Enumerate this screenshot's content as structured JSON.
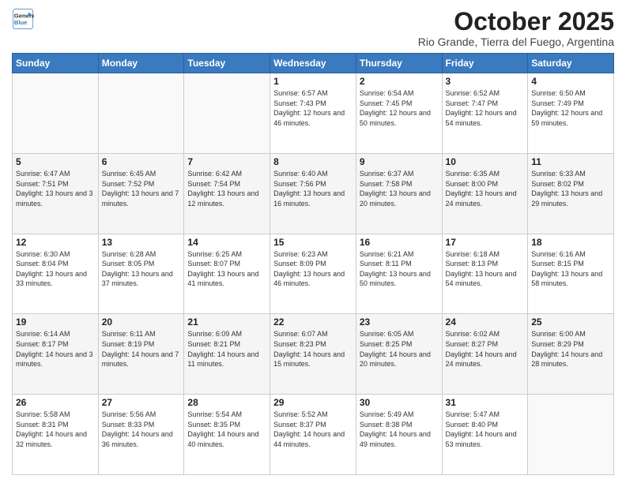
{
  "logo": {
    "line1": "General",
    "line2": "Blue"
  },
  "header": {
    "month": "October 2025",
    "location": "Rio Grande, Tierra del Fuego, Argentina"
  },
  "weekdays": [
    "Sunday",
    "Monday",
    "Tuesday",
    "Wednesday",
    "Thursday",
    "Friday",
    "Saturday"
  ],
  "weeks": [
    [
      {
        "day": "",
        "info": ""
      },
      {
        "day": "",
        "info": ""
      },
      {
        "day": "",
        "info": ""
      },
      {
        "day": "1",
        "info": "Sunrise: 6:57 AM\nSunset: 7:43 PM\nDaylight: 12 hours\nand 46 minutes."
      },
      {
        "day": "2",
        "info": "Sunrise: 6:54 AM\nSunset: 7:45 PM\nDaylight: 12 hours\nand 50 minutes."
      },
      {
        "day": "3",
        "info": "Sunrise: 6:52 AM\nSunset: 7:47 PM\nDaylight: 12 hours\nand 54 minutes."
      },
      {
        "day": "4",
        "info": "Sunrise: 6:50 AM\nSunset: 7:49 PM\nDaylight: 12 hours\nand 59 minutes."
      }
    ],
    [
      {
        "day": "5",
        "info": "Sunrise: 6:47 AM\nSunset: 7:51 PM\nDaylight: 13 hours\nand 3 minutes."
      },
      {
        "day": "6",
        "info": "Sunrise: 6:45 AM\nSunset: 7:52 PM\nDaylight: 13 hours\nand 7 minutes."
      },
      {
        "day": "7",
        "info": "Sunrise: 6:42 AM\nSunset: 7:54 PM\nDaylight: 13 hours\nand 12 minutes."
      },
      {
        "day": "8",
        "info": "Sunrise: 6:40 AM\nSunset: 7:56 PM\nDaylight: 13 hours\nand 16 minutes."
      },
      {
        "day": "9",
        "info": "Sunrise: 6:37 AM\nSunset: 7:58 PM\nDaylight: 13 hours\nand 20 minutes."
      },
      {
        "day": "10",
        "info": "Sunrise: 6:35 AM\nSunset: 8:00 PM\nDaylight: 13 hours\nand 24 minutes."
      },
      {
        "day": "11",
        "info": "Sunrise: 6:33 AM\nSunset: 8:02 PM\nDaylight: 13 hours\nand 29 minutes."
      }
    ],
    [
      {
        "day": "12",
        "info": "Sunrise: 6:30 AM\nSunset: 8:04 PM\nDaylight: 13 hours\nand 33 minutes."
      },
      {
        "day": "13",
        "info": "Sunrise: 6:28 AM\nSunset: 8:05 PM\nDaylight: 13 hours\nand 37 minutes."
      },
      {
        "day": "14",
        "info": "Sunrise: 6:25 AM\nSunset: 8:07 PM\nDaylight: 13 hours\nand 41 minutes."
      },
      {
        "day": "15",
        "info": "Sunrise: 6:23 AM\nSunset: 8:09 PM\nDaylight: 13 hours\nand 46 minutes."
      },
      {
        "day": "16",
        "info": "Sunrise: 6:21 AM\nSunset: 8:11 PM\nDaylight: 13 hours\nand 50 minutes."
      },
      {
        "day": "17",
        "info": "Sunrise: 6:18 AM\nSunset: 8:13 PM\nDaylight: 13 hours\nand 54 minutes."
      },
      {
        "day": "18",
        "info": "Sunrise: 6:16 AM\nSunset: 8:15 PM\nDaylight: 13 hours\nand 58 minutes."
      }
    ],
    [
      {
        "day": "19",
        "info": "Sunrise: 6:14 AM\nSunset: 8:17 PM\nDaylight: 14 hours\nand 3 minutes."
      },
      {
        "day": "20",
        "info": "Sunrise: 6:11 AM\nSunset: 8:19 PM\nDaylight: 14 hours\nand 7 minutes."
      },
      {
        "day": "21",
        "info": "Sunrise: 6:09 AM\nSunset: 8:21 PM\nDaylight: 14 hours\nand 11 minutes."
      },
      {
        "day": "22",
        "info": "Sunrise: 6:07 AM\nSunset: 8:23 PM\nDaylight: 14 hours\nand 15 minutes."
      },
      {
        "day": "23",
        "info": "Sunrise: 6:05 AM\nSunset: 8:25 PM\nDaylight: 14 hours\nand 20 minutes."
      },
      {
        "day": "24",
        "info": "Sunrise: 6:02 AM\nSunset: 8:27 PM\nDaylight: 14 hours\nand 24 minutes."
      },
      {
        "day": "25",
        "info": "Sunrise: 6:00 AM\nSunset: 8:29 PM\nDaylight: 14 hours\nand 28 minutes."
      }
    ],
    [
      {
        "day": "26",
        "info": "Sunrise: 5:58 AM\nSunset: 8:31 PM\nDaylight: 14 hours\nand 32 minutes."
      },
      {
        "day": "27",
        "info": "Sunrise: 5:56 AM\nSunset: 8:33 PM\nDaylight: 14 hours\nand 36 minutes."
      },
      {
        "day": "28",
        "info": "Sunrise: 5:54 AM\nSunset: 8:35 PM\nDaylight: 14 hours\nand 40 minutes."
      },
      {
        "day": "29",
        "info": "Sunrise: 5:52 AM\nSunset: 8:37 PM\nDaylight: 14 hours\nand 44 minutes."
      },
      {
        "day": "30",
        "info": "Sunrise: 5:49 AM\nSunset: 8:38 PM\nDaylight: 14 hours\nand 49 minutes."
      },
      {
        "day": "31",
        "info": "Sunrise: 5:47 AM\nSunset: 8:40 PM\nDaylight: 14 hours\nand 53 minutes."
      },
      {
        "day": "",
        "info": ""
      }
    ]
  ]
}
